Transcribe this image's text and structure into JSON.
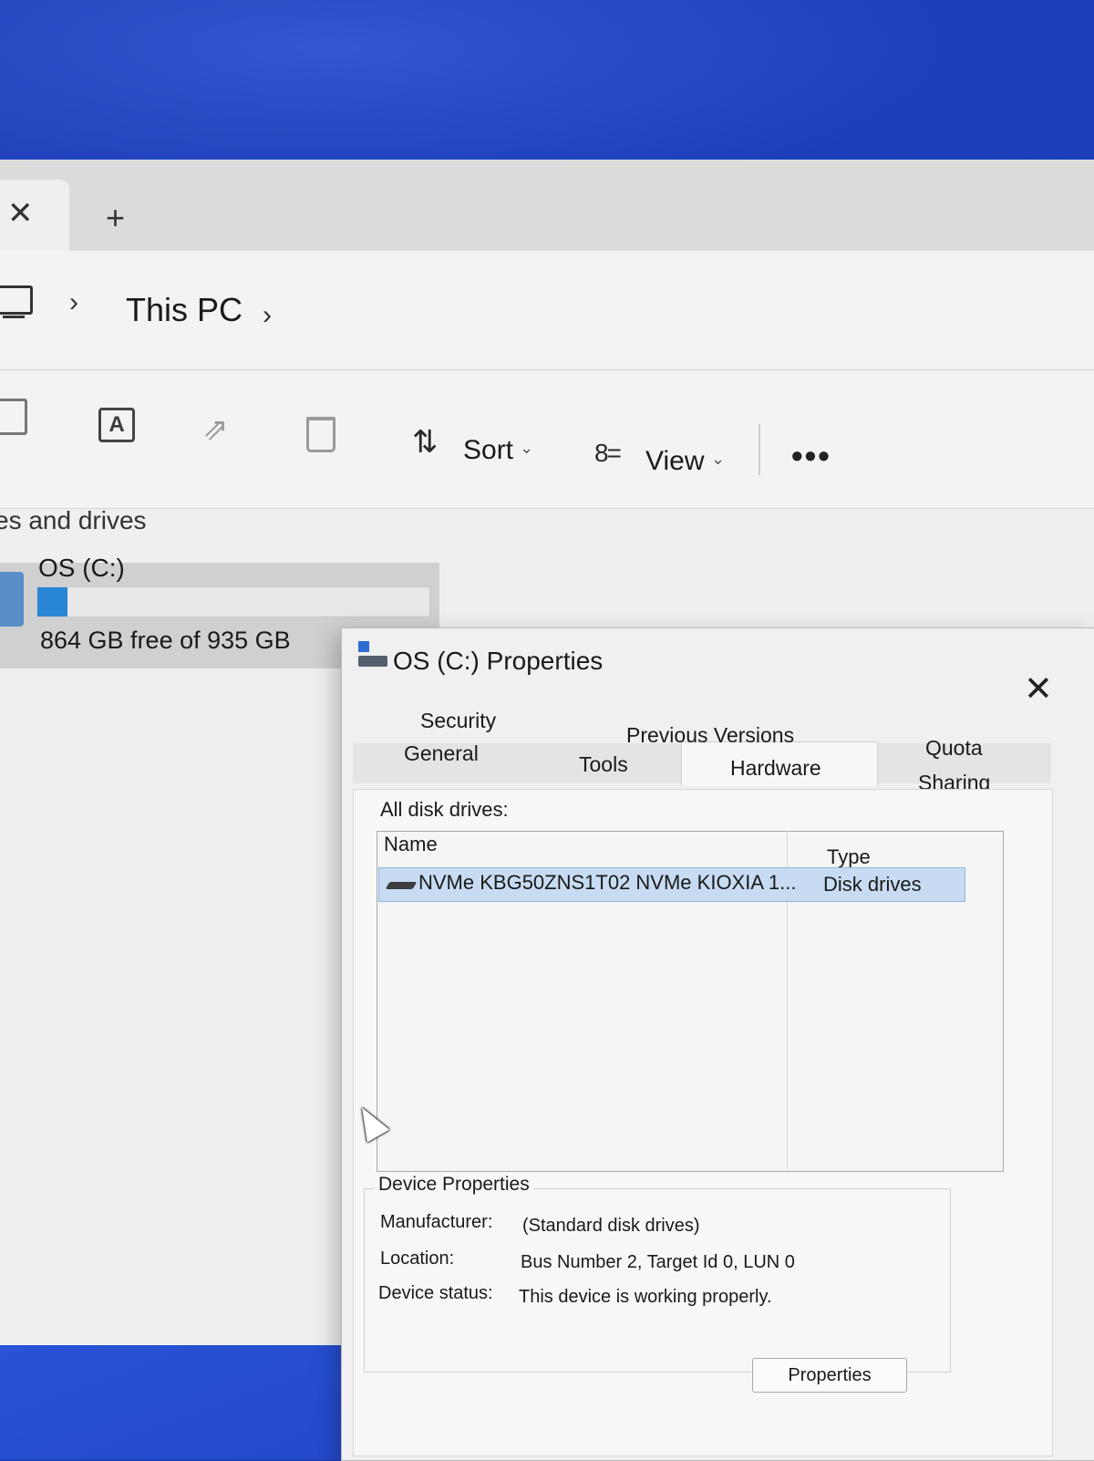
{
  "explorer": {
    "tab_close_icon": "✕",
    "tab_new_icon": "+",
    "breadcrumb": {
      "sep1": "›",
      "current": "This PC",
      "sep2": "›"
    },
    "toolbar": {
      "rename_glyph": "A",
      "share_glyph": "⇗",
      "sort_icon": "⇅",
      "sort_label": "Sort",
      "sort_chevron": "⌄",
      "view_icon": "8=",
      "view_label": "View",
      "view_chevron": "⌄",
      "more_label": "•••"
    },
    "section_label": "es and drives",
    "drive": {
      "name": "OS (C:)",
      "free_text": "864 GB free of 935 GB",
      "used_fraction": 0.076,
      "bar_color": "#2a86d6"
    }
  },
  "dialog": {
    "title": "OS (C:) Properties",
    "close_icon": "✕",
    "tabs": {
      "security": "Security",
      "previous_versions": "Previous Versions",
      "quota": "Quota",
      "general": "General",
      "tools": "Tools",
      "hardware": "Hardware",
      "sharing": "Sharing"
    },
    "active_tab": "Hardware",
    "all_disk_drives_label": "All disk drives:",
    "columns": {
      "name": "Name",
      "type": "Type"
    },
    "rows": [
      {
        "name": "NVMe KBG50ZNS1T02 NVMe KIOXIA 1...",
        "type": "Disk drives"
      }
    ],
    "device_properties": {
      "title": "Device Properties",
      "manufacturer_label": "Manufacturer:",
      "manufacturer_value": "(Standard disk drives)",
      "location_label": "Location:",
      "location_value": "Bus Number 2, Target Id 0, LUN 0",
      "status_label": "Device status:",
      "status_value": "This device is working properly."
    },
    "properties_button": "Properties"
  },
  "colors": {
    "desktop_blue": "#1f3fb8",
    "selection": "#c7dcf2"
  }
}
